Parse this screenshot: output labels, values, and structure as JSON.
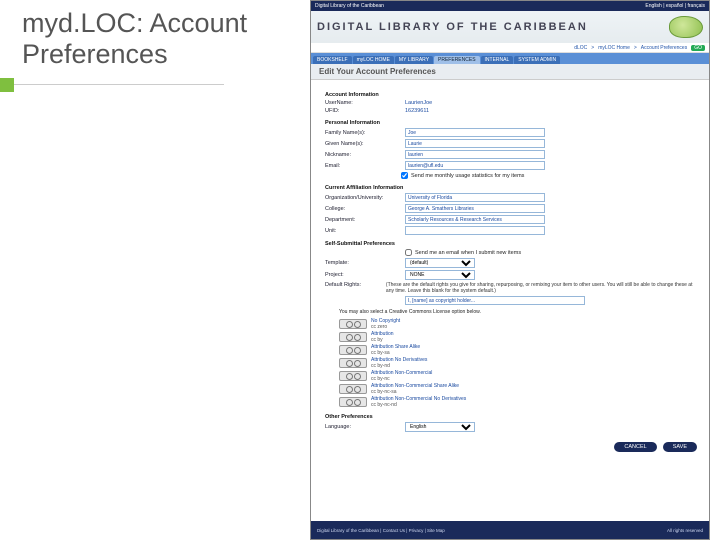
{
  "slide": {
    "title": "myd.LOC: Account\nPreferences"
  },
  "topbar": {
    "left": "Digital Library of the Caribbean",
    "right": "English  |  español  |  français"
  },
  "brand": {
    "text": "DIGITAL LIBRARY OF THE CARIBBEAN"
  },
  "crumbs": {
    "parts": [
      "dLOC",
      "myLOC Home",
      "Account Preferences"
    ],
    "go": "GO"
  },
  "tabs": [
    {
      "label": "BOOKSHELF"
    },
    {
      "label": "myLOC HOME"
    },
    {
      "label": "MY LIBRARY"
    },
    {
      "label": "PREFERENCES",
      "active": true
    },
    {
      "label": "INTERNAL"
    },
    {
      "label": "SYSTEM ADMIN"
    }
  ],
  "page": {
    "header": "Edit Your Account Preferences"
  },
  "sections": {
    "account": {
      "heading": "Account Information",
      "username_label": "UserName:",
      "username_value": "LaurienJoe",
      "ufid_label": "UFID:",
      "ufid_value": "16239611"
    },
    "personal": {
      "heading": "Personal Information",
      "family_label": "Family Name(s):",
      "family_value": "Joe",
      "given_label": "Given Name(s):",
      "given_value": "Laurie",
      "nickname_label": "Nickname:",
      "nickname_value": "laurien",
      "email_label": "Email:",
      "email_value": "laurien@ufl.edu",
      "email_check": "Send me monthly usage statistics for my items"
    },
    "affiliation": {
      "heading": "Current Affiliation Information",
      "org_label": "Organization/University:",
      "org_value": "University of Florida",
      "college_label": "College:",
      "college_value": "George A. Smathers Libraries",
      "dept_label": "Department:",
      "dept_value": "Scholarly Resources & Research Services",
      "unit_label": "Unit:",
      "unit_value": ""
    },
    "self_submit": {
      "heading": "Self-Submittal Preferences",
      "email_check": "Send me an email when I submit new items",
      "template_label": "Template:",
      "template_value": "(default)",
      "project_label": "Project:",
      "project_value": "NONE",
      "rights_label": "Default Rights:",
      "rights_hint": "(These are the default rights you give for sharing, repurposing, or remixing your item to other users. You will still be able to change these at any time. Leave this blank for the system default.)",
      "rights_value": "I, [name] as copyright holder..."
    },
    "cc": {
      "intro": "You may also select a Creative Commons License option below.",
      "items": [
        {
          "title": "No Copyright",
          "desc": "cc zero"
        },
        {
          "title": "Attribution",
          "desc": "cc by"
        },
        {
          "title": "Attribution Share Alike",
          "desc": "cc by-sa"
        },
        {
          "title": "Attribution No Derivatives",
          "desc": "cc by-nd"
        },
        {
          "title": "Attribution Non-Commercial",
          "desc": "cc by-nc"
        },
        {
          "title": "Attribution Non-Commercial Share Alike",
          "desc": "cc by-nc-sa"
        },
        {
          "title": "Attribution Non-Commercial No Derivatives",
          "desc": "cc by-nc-nd"
        }
      ]
    },
    "other": {
      "heading": "Other Preferences",
      "language_label": "Language:",
      "language_value": "English"
    }
  },
  "buttons": {
    "cancel": "CANCEL",
    "save": "SAVE"
  },
  "footer": {
    "left": "Digital Library of the Caribbean | Contact Us | Privacy | Site Map",
    "right": "All rights reserved"
  }
}
